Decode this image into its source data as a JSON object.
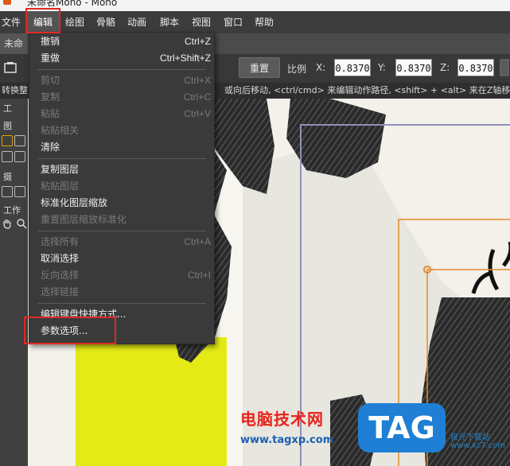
{
  "window": {
    "title": "未命名Moho - Moho"
  },
  "menubar": {
    "items": [
      {
        "id": "file",
        "label": "文件"
      },
      {
        "id": "edit",
        "label": "编辑"
      },
      {
        "id": "draw",
        "label": "绘图"
      },
      {
        "id": "bone",
        "label": "骨骼"
      },
      {
        "id": "animation",
        "label": "动画"
      },
      {
        "id": "script",
        "label": "脚本"
      },
      {
        "id": "view",
        "label": "视图"
      },
      {
        "id": "window",
        "label": "窗口"
      },
      {
        "id": "help",
        "label": "帮助"
      }
    ],
    "active": "edit"
  },
  "tabs": {
    "document": "未命"
  },
  "toolbar": {
    "reset_label": "重置",
    "scale_label": "比例",
    "x_label": "X:",
    "x_value": "0.8370",
    "y_label": "Y:",
    "y_value": "0.8370",
    "z_label": "Z:",
    "z_value": "0.8370"
  },
  "hint_bar": {
    "left": "转换整",
    "text": "或向后移动, <ctrl/cmd> 来编辑动作路径, <shift> + <alt> 来在Z轴移"
  },
  "side_panel": {
    "labels": [
      "工",
      "图",
      "摄",
      "工作"
    ]
  },
  "edit_menu": {
    "groups": [
      [
        {
          "label": "撤销",
          "shortcut": "Ctrl+Z",
          "enabled": true
        },
        {
          "label": "重做",
          "shortcut": "Ctrl+Shift+Z",
          "enabled": true
        }
      ],
      [
        {
          "label": "剪切",
          "shortcut": "Ctrl+X",
          "enabled": false
        },
        {
          "label": "复制",
          "shortcut": "Ctrl+C",
          "enabled": false
        },
        {
          "label": "粘贴",
          "shortcut": "Ctrl+V",
          "enabled": false
        },
        {
          "label": "粘贴相关",
          "shortcut": "",
          "enabled": false
        },
        {
          "label": "清除",
          "shortcut": "",
          "enabled": true
        }
      ],
      [
        {
          "label": "复制图层",
          "shortcut": "",
          "enabled": true
        },
        {
          "label": "粘贴图层",
          "shortcut": "",
          "enabled": false
        },
        {
          "label": "标准化图层缩放",
          "shortcut": "",
          "enabled": true
        },
        {
          "label": "重置图层缩放标准化",
          "shortcut": "",
          "enabled": false
        }
      ],
      [
        {
          "label": "选择所有",
          "shortcut": "Ctrl+A",
          "enabled": false
        },
        {
          "label": "取消选择",
          "shortcut": "",
          "enabled": true
        },
        {
          "label": "反向选择",
          "shortcut": "Ctrl+I",
          "enabled": false
        },
        {
          "label": "选择链接",
          "shortcut": "",
          "enabled": false
        }
      ],
      [
        {
          "label": "编辑键盘快捷方式...",
          "shortcut": "",
          "enabled": true
        },
        {
          "label": "参数选项...",
          "shortcut": "",
          "enabled": true
        }
      ]
    ],
    "highlighted_item": "参数选项..."
  },
  "watermark": {
    "site_name": "电脑技术网",
    "url": "www.tagxp.com",
    "logo_text": "TAG",
    "small_text": "极光下载站",
    "small_url": "www.xz7.com"
  },
  "colors": {
    "menu_bg": "#3a3a3a",
    "highlight": "#e02a22",
    "canvas_yellow": "#e3ea16",
    "selection_orange": "#e58a2b",
    "frame_blue": "#8f8fb8"
  }
}
